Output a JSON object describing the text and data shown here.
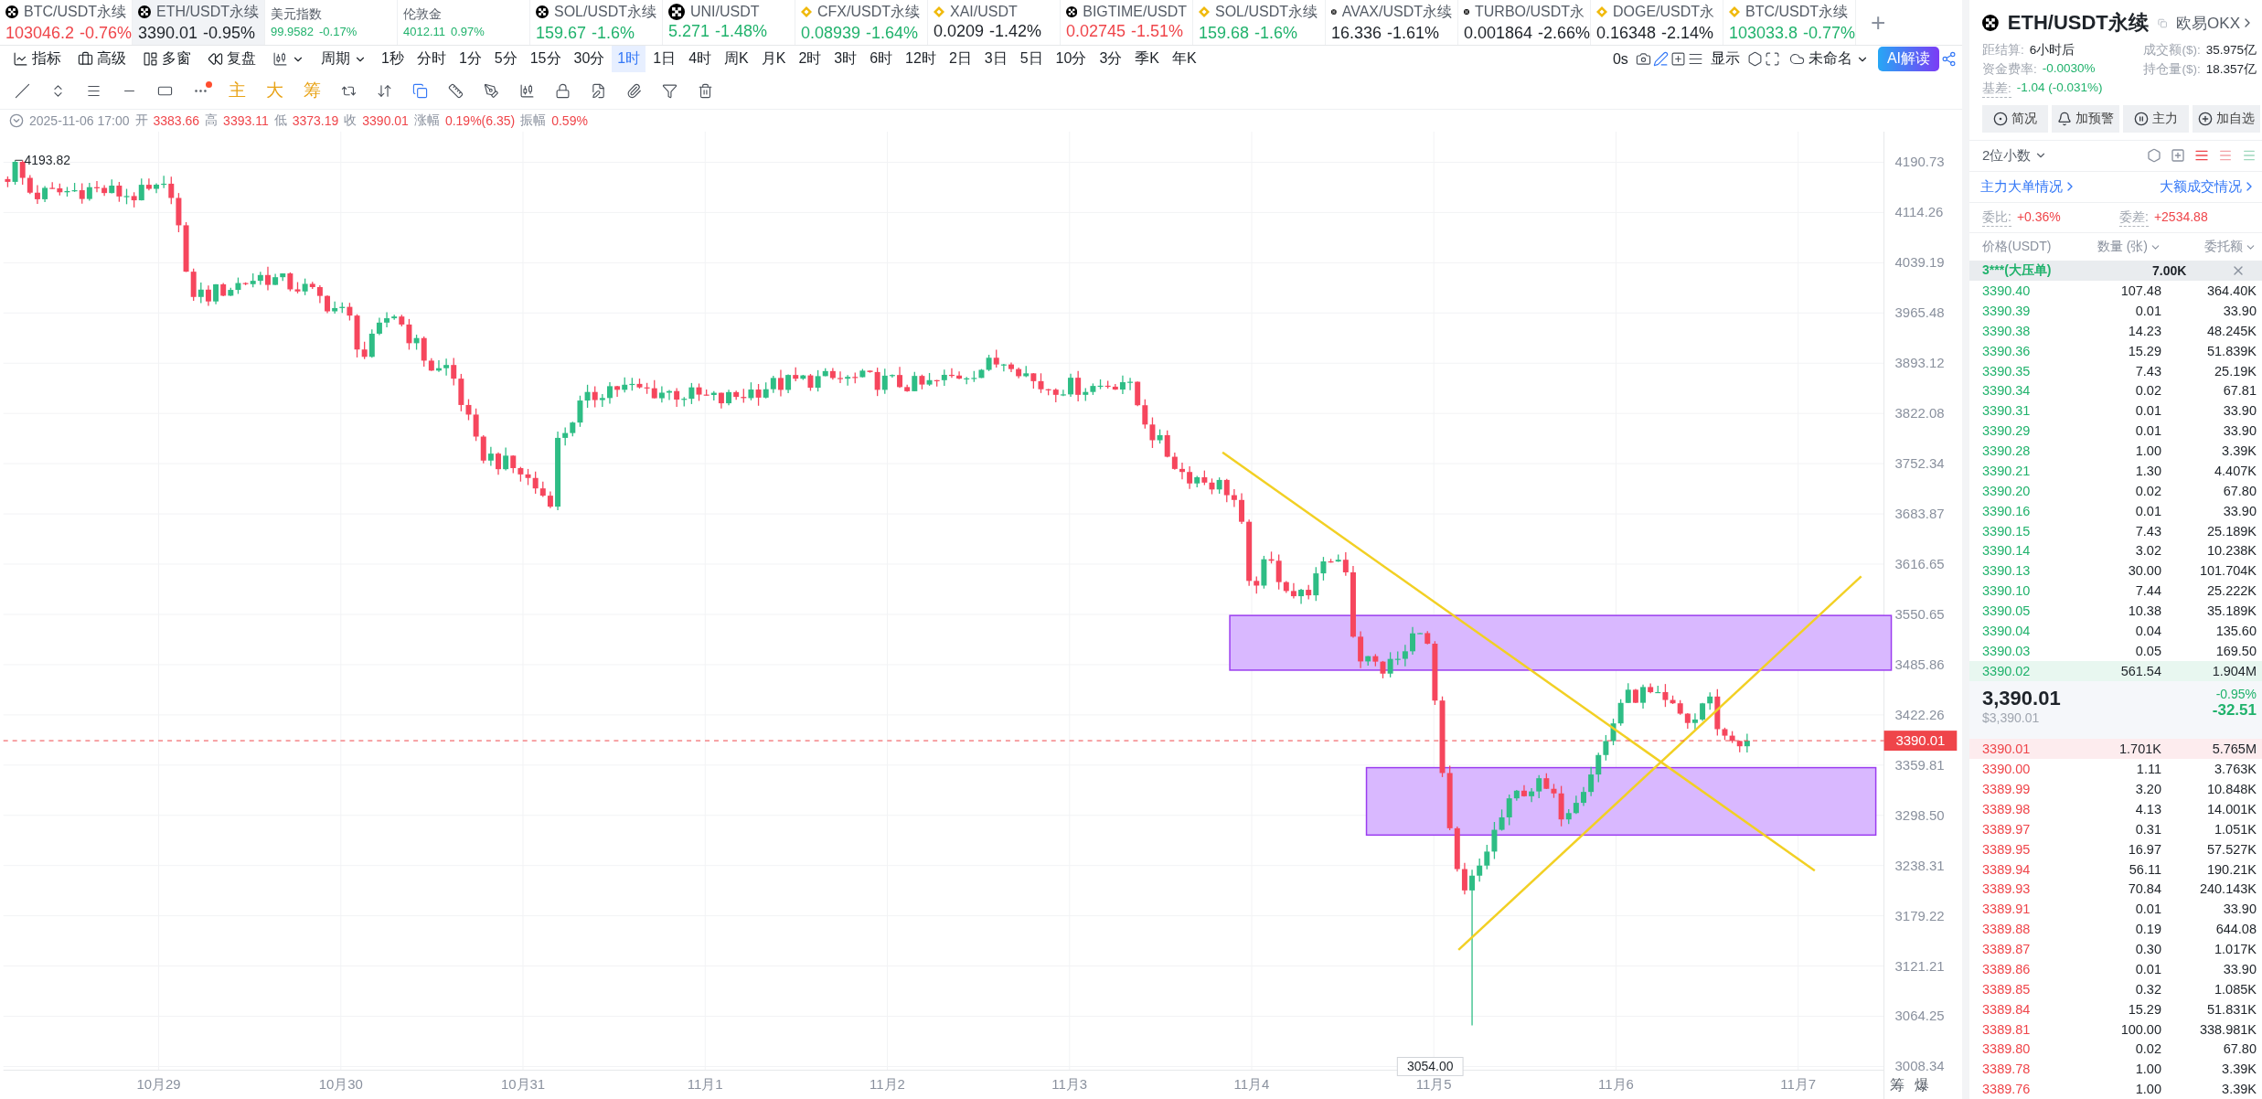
{
  "tickers": [
    {
      "kind": "okx",
      "name": "BTC/USDT永续",
      "price": "103046.2",
      "change": "-0.76%",
      "color": "#ef454a",
      "selected": false,
      "compact": false
    },
    {
      "kind": "okx",
      "name": "ETH/USDT永续",
      "price": "3390.01",
      "change": "-0.95%",
      "color": "#1e2329",
      "selected": true,
      "compact": false
    },
    {
      "kind": "plain",
      "name": "美元指数",
      "price": "99.9582",
      "change": "-0.17%",
      "color": "#20b26c",
      "selected": false,
      "compact": true
    },
    {
      "kind": "plain",
      "name": "伦敦金",
      "price": "4012.11",
      "change": "0.97%",
      "color": "#20b26c",
      "selected": false,
      "compact": true
    },
    {
      "kind": "okx",
      "name": "SOL/USDT永续",
      "price": "159.67",
      "change": "-1.6%",
      "color": "#20b26c",
      "selected": false,
      "compact": false
    },
    {
      "kind": "okx",
      "name": "UNI/USDT",
      "price": "5.271",
      "change": "-1.48%",
      "color": "#20b26c",
      "selected": false,
      "compact": false
    },
    {
      "kind": "binance",
      "name": "CFX/USDT永续",
      "price": "0.08939",
      "change": "-1.64%",
      "color": "#20b26c",
      "selected": false,
      "compact": false
    },
    {
      "kind": "binance",
      "name": "XAI/USDT",
      "price": "0.0209",
      "change": "-1.42%",
      "color": "#1e2329",
      "selected": false,
      "compact": false
    },
    {
      "kind": "okx",
      "name": "BIGTIME/USDT",
      "price": "0.02745",
      "change": "-1.51%",
      "color": "#ef454a",
      "selected": false,
      "compact": false
    },
    {
      "kind": "binance",
      "name": "SOL/USDT永续",
      "price": "159.68",
      "change": "-1.6%",
      "color": "#20b26c",
      "selected": false,
      "compact": false
    },
    {
      "kind": "okx",
      "name": "AVAX/USDT永续",
      "price": "16.336",
      "change": "-1.61%",
      "color": "#1e2329",
      "selected": false,
      "compact": false
    },
    {
      "kind": "okx",
      "name": "TURBO/USDT永",
      "price": "0.001864",
      "change": "-2.66%",
      "color": "#1e2329",
      "selected": false,
      "compact": false
    },
    {
      "kind": "binance",
      "name": "DOGE/USDT永",
      "price": "0.16348",
      "change": "-2.14%",
      "color": "#1e2329",
      "selected": false,
      "compact": false
    },
    {
      "kind": "binance",
      "name": "BTC/USDT永续",
      "price": "103033.8",
      "change": "-0.77%",
      "color": "#20b26c",
      "selected": false,
      "compact": false
    }
  ],
  "add_tab": "+",
  "toolbar": {
    "tools": [
      {
        "kind": "indicator",
        "label": "指标"
      },
      {
        "kind": "advanced",
        "label": "高级"
      },
      {
        "kind": "multi",
        "label": "多窗"
      },
      {
        "kind": "replay",
        "label": "复盘"
      }
    ],
    "period": "周期",
    "intervals": [
      {
        "label": "1秒",
        "selected": false
      },
      {
        "label": "分时",
        "selected": false
      },
      {
        "label": "1分",
        "selected": false
      },
      {
        "label": "5分",
        "selected": false
      },
      {
        "label": "15分",
        "selected": false
      },
      {
        "label": "30分",
        "selected": false
      },
      {
        "label": "1时",
        "selected": true
      },
      {
        "label": "1日",
        "selected": false
      },
      {
        "label": "4时",
        "selected": false
      },
      {
        "label": "周K",
        "selected": false
      },
      {
        "label": "月K",
        "selected": false
      },
      {
        "label": "2时",
        "selected": false
      },
      {
        "label": "3时",
        "selected": false
      },
      {
        "label": "6时",
        "selected": false
      },
      {
        "label": "12时",
        "selected": false
      },
      {
        "label": "2日",
        "selected": false
      },
      {
        "label": "3日",
        "selected": false
      },
      {
        "label": "5日",
        "selected": false
      },
      {
        "label": "10分",
        "selected": false
      },
      {
        "label": "3分",
        "selected": false
      },
      {
        "label": "季K",
        "selected": false
      },
      {
        "label": "年K",
        "selected": false
      }
    ],
    "timer": "0s",
    "display": "显示",
    "layout_name": "未命名",
    "ai_button": "AI解读"
  },
  "drawing_marks": [
    "主",
    "大",
    "筹"
  ],
  "ohlc": {
    "time": "2025-11-06 17:00",
    "fields": [
      {
        "label": "开",
        "value": "3383.66"
      },
      {
        "label": "高",
        "value": "3393.11"
      },
      {
        "label": "低",
        "value": "3373.19"
      },
      {
        "label": "收",
        "value": "3390.01"
      },
      {
        "label": "涨幅",
        "value": "0.19%(6.35)"
      },
      {
        "label": "振幅",
        "value": "0.59%"
      }
    ]
  },
  "chart": {
    "price_axis": [
      "4190.73",
      "4114.26",
      "4039.19",
      "3965.48",
      "3893.12",
      "3822.08",
      "3752.34",
      "3683.87",
      "3616.65",
      "3550.65",
      "3485.86",
      "3422.26",
      "3359.81",
      "3298.50",
      "3238.31",
      "3179.22",
      "3121.21",
      "3064.25",
      "3008.34"
    ],
    "date_axis": [
      "10月29",
      "10月30",
      "10月31",
      "11月1",
      "11月2",
      "11月3",
      "11月4",
      "11月5",
      "11月6",
      "11月7"
    ],
    "last_price": "3390.01",
    "high_mark": "4193.82",
    "low_mark": "3054.00",
    "footer": [
      "筹",
      "爆"
    ]
  },
  "panel": {
    "symbol": "ETH/USDT永续",
    "exchange": "欧易OKX",
    "stats_left": [
      {
        "label": "距结算:",
        "value": "6小时后",
        "color": "#1e2329"
      },
      {
        "label": "资金费率:",
        "value": "-0.0030%",
        "color": "#20b26c"
      },
      {
        "label": "基差:",
        "value": "-1.04 (-0.031%)",
        "color": "#20b26c"
      }
    ],
    "stats_right": [
      {
        "label": "成交额($):",
        "value": "35.975亿"
      },
      {
        "label": "持仓量($):",
        "value": "18.357亿"
      }
    ],
    "buttons": [
      {
        "kind": "brief",
        "label": "简况"
      },
      {
        "kind": "alert",
        "label": "加预警"
      },
      {
        "kind": "main",
        "label": "主力"
      },
      {
        "kind": "add",
        "label": "加自选"
      }
    ],
    "decimals": "2位小数",
    "links": [
      "主力大单情况",
      "大额成交情况"
    ],
    "ratio": {
      "label": "委比:",
      "value": "+0.36%"
    },
    "diff": {
      "label": "委差:",
      "value": "+2534.88"
    },
    "columns": [
      "价格(USDT)",
      "数量 (张)",
      "委托额"
    ],
    "big_order": {
      "label": "3***(大压单)",
      "amount": "7.00K"
    },
    "asks": [
      {
        "price": "3390.40",
        "qty": "107.48",
        "amount": "364.40K",
        "highlighted": false
      },
      {
        "price": "3390.39",
        "qty": "0.01",
        "amount": "33.90",
        "highlighted": false
      },
      {
        "price": "3390.38",
        "qty": "14.23",
        "amount": "48.245K",
        "highlighted": false
      },
      {
        "price": "3390.36",
        "qty": "15.29",
        "amount": "51.839K",
        "highlighted": false
      },
      {
        "price": "3390.35",
        "qty": "7.43",
        "amount": "25.19K",
        "highlighted": false
      },
      {
        "price": "3390.34",
        "qty": "0.02",
        "amount": "67.81",
        "highlighted": false
      },
      {
        "price": "3390.31",
        "qty": "0.01",
        "amount": "33.90",
        "highlighted": false
      },
      {
        "price": "3390.29",
        "qty": "0.01",
        "amount": "33.90",
        "highlighted": false
      },
      {
        "price": "3390.28",
        "qty": "1.00",
        "amount": "3.39K",
        "highlighted": false
      },
      {
        "price": "3390.21",
        "qty": "1.30",
        "amount": "4.407K",
        "highlighted": false
      },
      {
        "price": "3390.20",
        "qty": "0.02",
        "amount": "67.80",
        "highlighted": false
      },
      {
        "price": "3390.16",
        "qty": "0.01",
        "amount": "33.90",
        "highlighted": false
      },
      {
        "price": "3390.15",
        "qty": "7.43",
        "amount": "25.189K",
        "highlighted": false
      },
      {
        "price": "3390.14",
        "qty": "3.02",
        "amount": "10.238K",
        "highlighted": false
      },
      {
        "price": "3390.13",
        "qty": "30.00",
        "amount": "101.704K",
        "highlighted": false
      },
      {
        "price": "3390.10",
        "qty": "7.44",
        "amount": "25.222K",
        "highlighted": false
      },
      {
        "price": "3390.05",
        "qty": "10.38",
        "amount": "35.189K",
        "highlighted": false
      },
      {
        "price": "3390.04",
        "qty": "0.04",
        "amount": "135.60",
        "highlighted": false
      },
      {
        "price": "3390.03",
        "qty": "0.05",
        "amount": "169.50",
        "highlighted": false
      },
      {
        "price": "3390.02",
        "qty": "561.54",
        "amount": "1.904M",
        "highlighted": true
      }
    ],
    "last": {
      "price": "3,390.01",
      "usd": "$3,390.01",
      "change_pct": "-0.95%",
      "change": "-32.51"
    },
    "bids": [
      {
        "price": "3390.01",
        "qty": "1.701K",
        "amount": "5.765M",
        "highlighted": true
      },
      {
        "price": "3390.00",
        "qty": "1.11",
        "amount": "3.763K",
        "highlighted": false
      },
      {
        "price": "3389.99",
        "qty": "3.20",
        "amount": "10.848K",
        "highlighted": false
      },
      {
        "price": "3389.98",
        "qty": "4.13",
        "amount": "14.001K",
        "highlighted": false
      },
      {
        "price": "3389.97",
        "qty": "0.31",
        "amount": "1.051K",
        "highlighted": false
      },
      {
        "price": "3389.95",
        "qty": "16.97",
        "amount": "57.527K",
        "highlighted": false
      },
      {
        "price": "3389.94",
        "qty": "56.11",
        "amount": "190.21K",
        "highlighted": false
      },
      {
        "price": "3389.93",
        "qty": "70.84",
        "amount": "240.143K",
        "highlighted": false
      },
      {
        "price": "3389.91",
        "qty": "0.01",
        "amount": "33.90",
        "highlighted": false
      },
      {
        "price": "3389.88",
        "qty": "0.19",
        "amount": "644.08",
        "highlighted": false
      },
      {
        "price": "3389.87",
        "qty": "0.30",
        "amount": "1.017K",
        "highlighted": false
      },
      {
        "price": "3389.86",
        "qty": "0.01",
        "amount": "33.90",
        "highlighted": false
      },
      {
        "price": "3389.85",
        "qty": "0.32",
        "amount": "1.085K",
        "highlighted": false
      },
      {
        "price": "3389.84",
        "qty": "15.29",
        "amount": "51.831K",
        "highlighted": false
      },
      {
        "price": "3389.81",
        "qty": "100.00",
        "amount": "338.981K",
        "highlighted": false
      },
      {
        "price": "3389.80",
        "qty": "0.02",
        "amount": "67.80",
        "highlighted": false
      },
      {
        "price": "3389.78",
        "qty": "1.00",
        "amount": "3.39K",
        "highlighted": false
      },
      {
        "price": "3389.76",
        "qty": "1.00",
        "amount": "3.39K",
        "highlighted": false
      }
    ]
  }
}
